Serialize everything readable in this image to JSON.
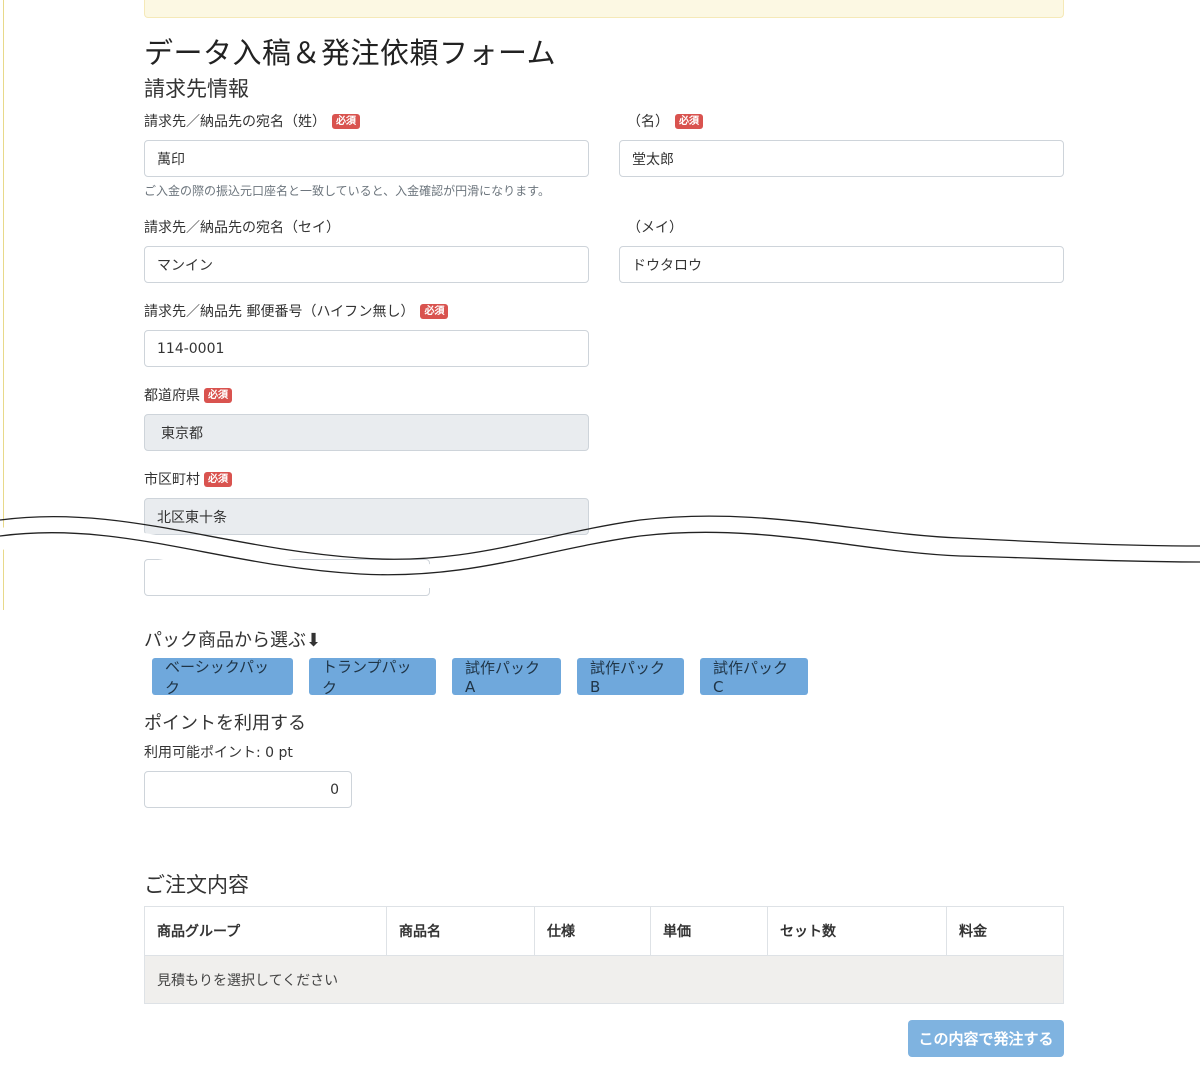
{
  "form": {
    "title": "データ入稿＆発注依頼フォーム",
    "billing_section": "請求先情報",
    "required_badge": "必須",
    "last_name": {
      "label": "請求先／納品先の宛名（姓）",
      "value": "萬印"
    },
    "first_name": {
      "label": "（名）",
      "value": "堂太郎"
    },
    "name_help": "ご入金の際の振込元口座名と一致していると、入金確認が円滑になります。",
    "last_kana": {
      "label": "請求先／納品先の宛名（セイ）",
      "value": "マンイン"
    },
    "first_kana": {
      "label": "（メイ）",
      "value": "ドウタロウ"
    },
    "postal": {
      "label": "請求先／納品先 郵便番号（ハイフン無し）",
      "value": "114-0001"
    },
    "prefecture": {
      "label": "都道府県",
      "value": "東京都"
    },
    "city": {
      "label": "市区町村",
      "value": "北区東十条"
    }
  },
  "pack": {
    "heading": "パック商品から選ぶ⬇",
    "buttons": [
      "ベーシックパック",
      "トランプパック",
      "試作パックA",
      "試作パックB",
      "試作パックC"
    ]
  },
  "points": {
    "heading": "ポイントを利用する",
    "available": "利用可能ポイント: 0 pt",
    "value": "0"
  },
  "order": {
    "heading": "ご注文内容",
    "columns": [
      "商品グループ",
      "商品名",
      "仕様",
      "単価",
      "セット数",
      "料金"
    ],
    "empty_message": "見積もりを選択してください",
    "submit": "この内容で発注する"
  },
  "colors": {
    "accent": "#6fa8dc",
    "required": "#d9534f",
    "notice": "#fcf8e3"
  }
}
